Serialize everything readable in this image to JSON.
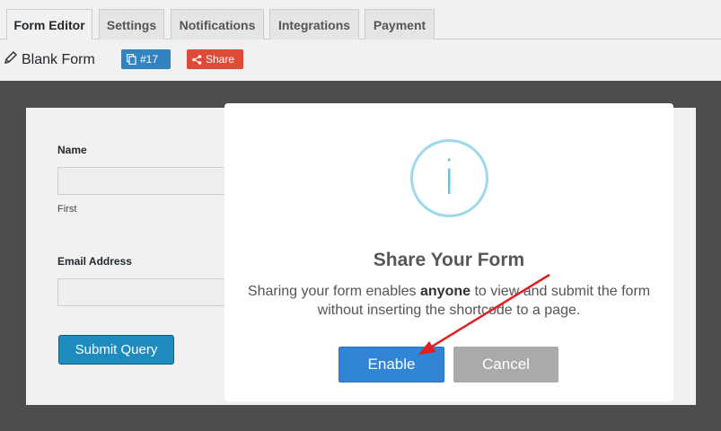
{
  "tabs": [
    {
      "label": "Form Editor",
      "active": true
    },
    {
      "label": "Settings",
      "active": false
    },
    {
      "label": "Notifications",
      "active": false
    },
    {
      "label": "Integrations",
      "active": false
    },
    {
      "label": "Payment",
      "active": false
    }
  ],
  "header": {
    "title": "Blank Form",
    "id_badge": "#17",
    "share_badge": "Share",
    "icons": {
      "title": "pencil-icon",
      "id": "copy-icon",
      "share": "share-icon"
    }
  },
  "form": {
    "name_label": "Name",
    "name_sub_label": "First",
    "email_label": "Email Address",
    "submit_label": "Submit Query"
  },
  "modal": {
    "icon": "info-icon",
    "icon_glyph": "i",
    "title": "Share Your Form",
    "text_before": "Sharing your form enables ",
    "text_bold": "anyone",
    "text_after": " to view and submit the form without inserting the shortcode to a page.",
    "enable_label": "Enable",
    "cancel_label": "Cancel"
  },
  "colors": {
    "primary": "#3085d6",
    "cancel": "#aaaaaa",
    "share_badge": "#dd4b39",
    "id_badge": "#2f83c0",
    "annotation_arrow": "#e02020"
  }
}
